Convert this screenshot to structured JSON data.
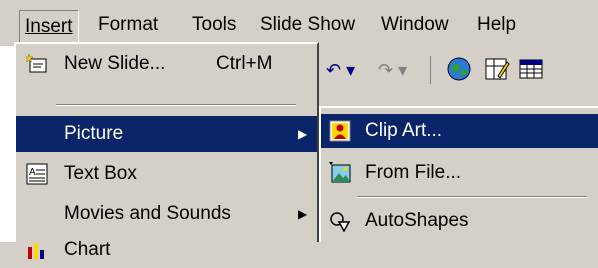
{
  "menubar": {
    "items": [
      {
        "label": "Insert"
      },
      {
        "label": "Format"
      },
      {
        "label": "Tools"
      },
      {
        "label": "Slide Show"
      },
      {
        "label": "Window"
      },
      {
        "label": "Help"
      }
    ]
  },
  "insert_menu": {
    "items": [
      {
        "label": "New Slide...",
        "shortcut": "Ctrl+M",
        "icon": "new-slide-icon"
      },
      {
        "label": "Picture",
        "icon": "none",
        "submenu": true,
        "highlighted": true
      },
      {
        "label": "Text Box",
        "icon": "text-box-icon"
      },
      {
        "label": "Movies and Sounds",
        "submenu": true
      },
      {
        "label": "Chart",
        "icon": "chart-icon"
      }
    ]
  },
  "picture_submenu": {
    "items": [
      {
        "label": "Clip Art...",
        "icon": "clip-art-icon",
        "highlighted": true
      },
      {
        "label": "From File...",
        "icon": "from-file-icon"
      },
      {
        "label": "AutoShapes",
        "icon": "autoshapes-icon"
      }
    ]
  },
  "colors": {
    "menu_face": "#d4d0c8",
    "highlight": "#0a246a",
    "highlight_text": "#ffffff"
  }
}
